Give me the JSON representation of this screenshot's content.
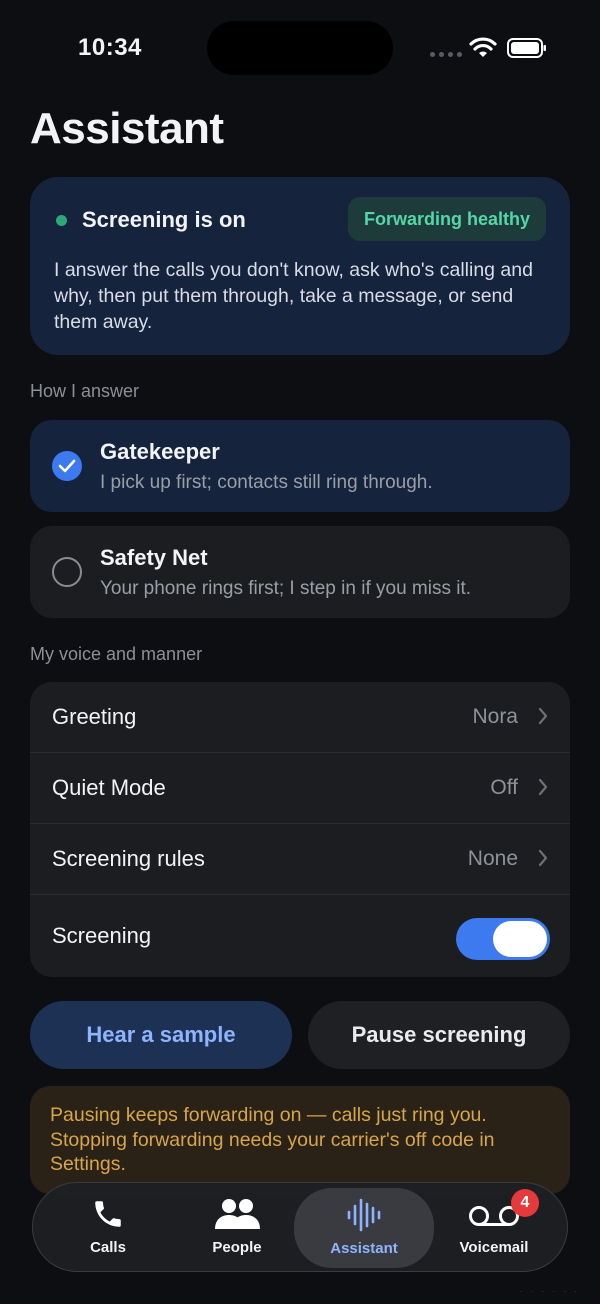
{
  "status": {
    "time": "10:34"
  },
  "page": {
    "title": "Assistant"
  },
  "hero": {
    "title": "Screening is on",
    "badge": "Forwarding healthy",
    "description": "I answer the calls you don't know, ask who's calling and why, then put them through, take a message, or send them away."
  },
  "answer_section": {
    "label": "How I answer",
    "options": [
      {
        "title": "Gatekeeper",
        "subtitle": "I pick up first; contacts still ring through.",
        "selected": true
      },
      {
        "title": "Safety Net",
        "subtitle": "Your phone rings first; I step in if you miss it.",
        "selected": false
      }
    ]
  },
  "voice_section": {
    "label": "My voice and manner",
    "rows": [
      {
        "label": "Greeting",
        "value": "Nora"
      },
      {
        "label": "Quiet Mode",
        "value": "Off"
      },
      {
        "label": "Screening rules",
        "value": "None"
      }
    ],
    "toggle_row": {
      "label": "Screening",
      "on": true
    }
  },
  "actions": {
    "sample": "Hear a sample",
    "pause": "Pause screening"
  },
  "note": "Pausing keeps forwarding on — calls just ring you. Stopping forwarding needs your carrier's off code in Settings.",
  "tabs": [
    {
      "label": "Calls",
      "icon": "phone-icon"
    },
    {
      "label": "People",
      "icon": "people-icon"
    },
    {
      "label": "Assistant",
      "icon": "waveform-icon",
      "active": true
    },
    {
      "label": "Voicemail",
      "icon": "voicemail-icon",
      "badge": "4"
    }
  ],
  "colors": {
    "accent": "#3d7af0",
    "healthy": "#55d6a6",
    "warning": "#d8a54b",
    "badge": "#e5393b"
  }
}
